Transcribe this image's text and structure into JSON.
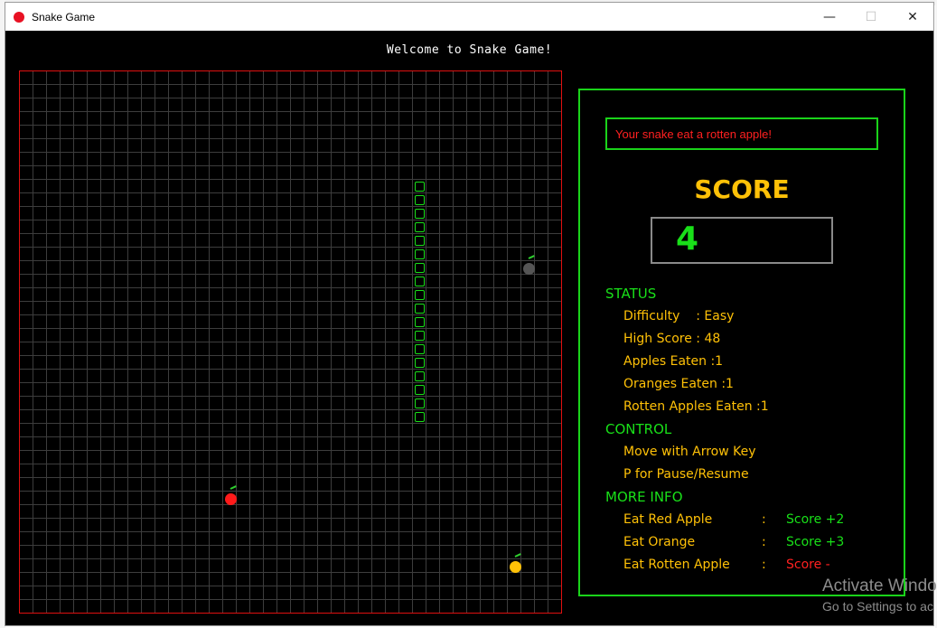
{
  "window": {
    "title": "Snake Game",
    "minimize_icon": "minimize-icon",
    "maximize_icon": "maximize-icon",
    "close_icon": "close-icon"
  },
  "welcome": "Welcome to Snake Game!",
  "board": {
    "columns": 40,
    "rows": 40,
    "snake": [
      [
        29,
        8
      ],
      [
        29,
        9
      ],
      [
        29,
        10
      ],
      [
        29,
        11
      ],
      [
        29,
        12
      ],
      [
        29,
        13
      ],
      [
        29,
        14
      ],
      [
        29,
        15
      ],
      [
        29,
        16
      ],
      [
        29,
        17
      ],
      [
        29,
        18
      ],
      [
        29,
        19
      ],
      [
        29,
        20
      ],
      [
        29,
        21
      ],
      [
        29,
        22
      ],
      [
        29,
        23
      ],
      [
        29,
        24
      ],
      [
        29,
        25
      ]
    ],
    "fruits": [
      {
        "kind": "red-apple",
        "col": 15.5,
        "row": 31.5,
        "color": "#ff1a1a"
      },
      {
        "kind": "rotten-apple",
        "col": 37.5,
        "row": 14.5,
        "color": "#555555"
      },
      {
        "kind": "orange",
        "col": 36.5,
        "row": 36.5,
        "color": "#ffc107"
      }
    ]
  },
  "panel": {
    "message": "Your snake eat a rotten apple!",
    "score_title": "SCORE",
    "score": "4",
    "status_title": "STATUS",
    "difficulty": "Difficulty    : Easy",
    "high_score": "High Score : 48",
    "apples_eaten": "Apples Eaten :1",
    "oranges_eaten": "Oranges Eaten :1",
    "rotten_eaten": "Rotten Apples Eaten :1",
    "control_title": "CONTROL",
    "control_move": "Move with Arrow Key",
    "control_pause": "P for Pause/Resume",
    "more_title": "MORE INFO",
    "info": [
      {
        "label": "Eat Red Apple",
        "value": "Score +2",
        "color": "green"
      },
      {
        "label": "Eat Orange",
        "value": "Score +3",
        "color": "green"
      },
      {
        "label": "Eat Rotten Apple",
        "value": "Score -",
        "color": "red"
      }
    ],
    "colon": ":"
  },
  "watermark": {
    "line1": "Activate Windo",
    "line2": "Go to Settings to ac"
  },
  "colors": {
    "grid_border": "#e01010",
    "panel_green": "#1ad31a",
    "accent_yellow": "#ffc107",
    "alert_red": "#ff2020"
  }
}
